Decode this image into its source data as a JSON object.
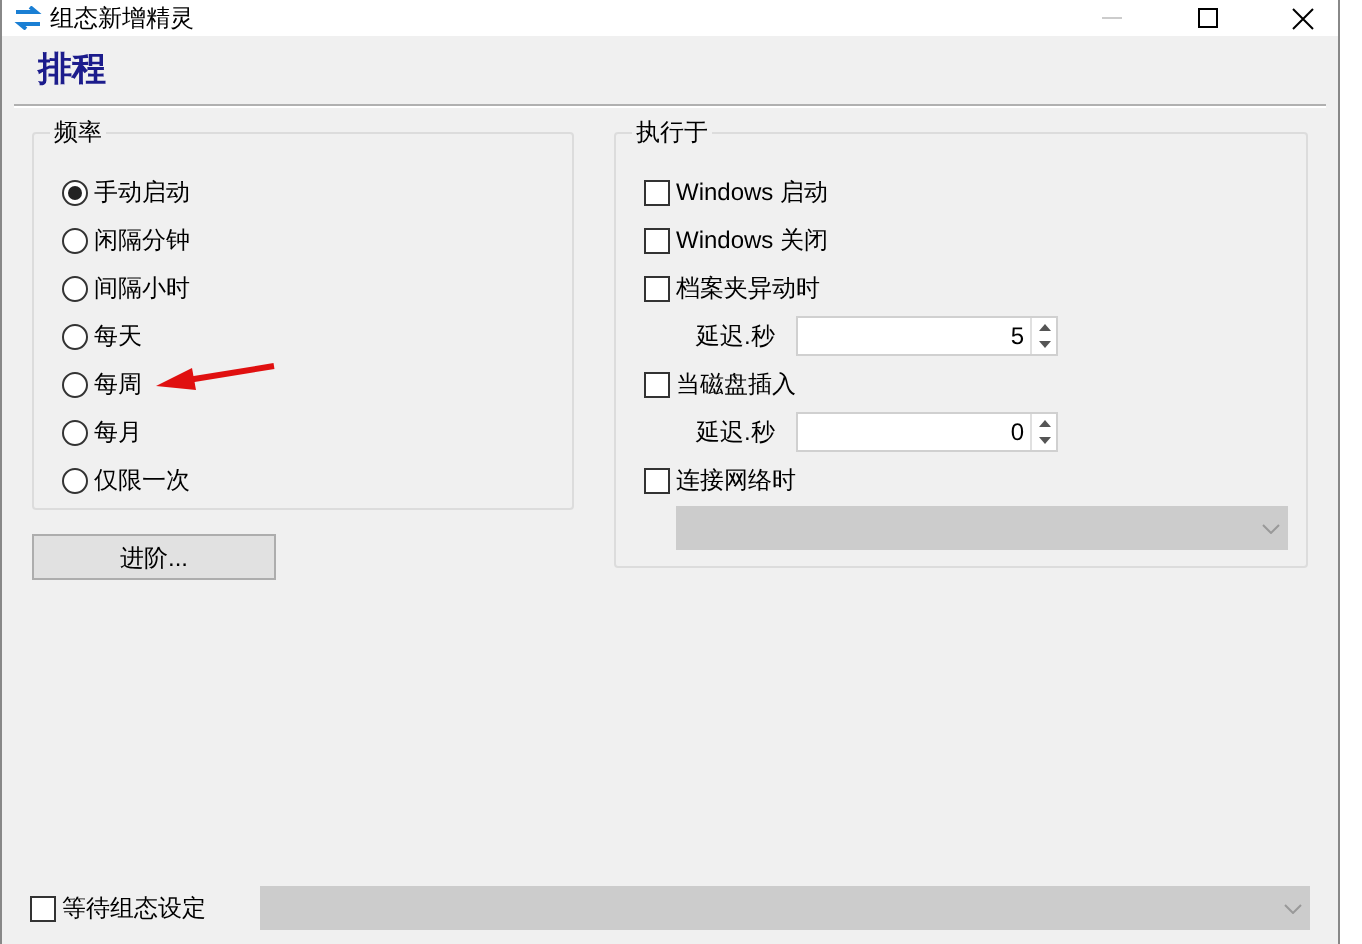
{
  "window": {
    "title": "组态新增精灵"
  },
  "header": {
    "title": "排程"
  },
  "frequency": {
    "legend": "频率",
    "options": [
      {
        "label": "手动启动",
        "selected": true
      },
      {
        "label": "闲隔分钟",
        "selected": false
      },
      {
        "label": "间隔小时",
        "selected": false
      },
      {
        "label": "每天",
        "selected": false
      },
      {
        "label": "每周",
        "selected": false
      },
      {
        "label": "每月",
        "selected": false
      },
      {
        "label": "仅限一次",
        "selected": false
      }
    ]
  },
  "advanced_button": "进阶...",
  "execute_on": {
    "legend": "执行于",
    "items": [
      {
        "kind": "checkbox",
        "label": "Windows 启动",
        "checked": false
      },
      {
        "kind": "checkbox",
        "label": "Windows 关闭",
        "checked": false
      },
      {
        "kind": "checkbox",
        "label": "档案夹异动时",
        "checked": false
      },
      {
        "kind": "spinner",
        "label": "延迟.秒",
        "value": "5"
      },
      {
        "kind": "checkbox",
        "label": "当磁盘插入",
        "checked": false
      },
      {
        "kind": "spinner",
        "label": "延迟.秒",
        "value": "0"
      },
      {
        "kind": "checkbox",
        "label": "连接网络时",
        "checked": false
      },
      {
        "kind": "dropdown",
        "disabled": true
      }
    ]
  },
  "footer": {
    "wait_checkbox": {
      "label": "等待组态设定",
      "checked": false
    },
    "dropdown": {
      "disabled": true
    }
  }
}
